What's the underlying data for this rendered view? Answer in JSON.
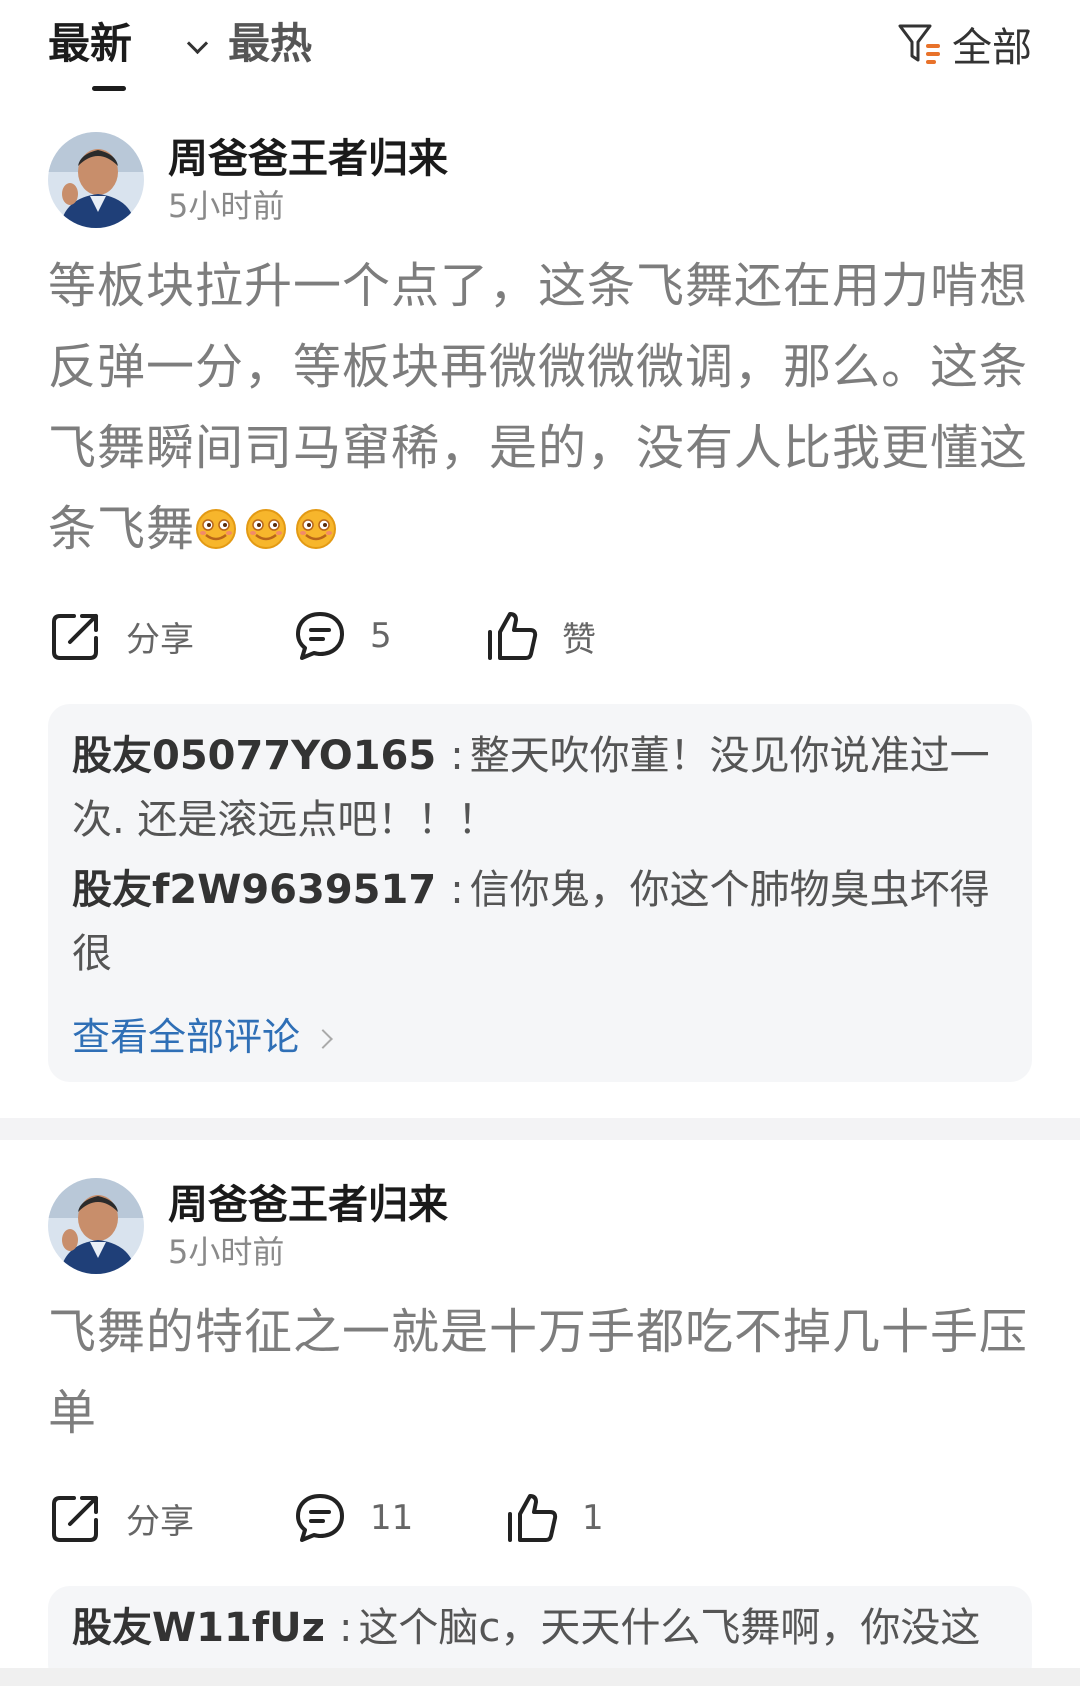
{
  "tabs": {
    "latest": "最新",
    "hot": "最热"
  },
  "filter": {
    "label": "全部"
  },
  "posts": [
    {
      "author": "周爸爸王者归来",
      "time": "5小时前",
      "content": "等板块拉升一个点了，这条飞舞还在用力啃想反弹一分，等板块再微微微微调，那么。这条飞舞瞬间司马窜稀，是的，没有人比我更懂这条飞舞",
      "emoji_count": 3,
      "actions": {
        "share": "分享",
        "comments": "5",
        "like": "赞"
      },
      "replies": [
        {
          "user": "股友05077YO165",
          "text": "整天吹你董！没见你说准过一次. 还是滚远点吧！！！"
        },
        {
          "user": "股友f2W9639517",
          "text": "信你鬼，你这个肺物臭虫坏得很"
        }
      ],
      "view_all": "查看全部评论"
    },
    {
      "author": "周爸爸王者归来",
      "time": "5小时前",
      "content": "飞舞的特征之一就是十万手都吃不掉几十手压单",
      "actions": {
        "share": "分享",
        "comments": "11",
        "like": "1"
      },
      "replies": [
        {
          "user": "股友W11fUz",
          "text": "这个脑c，天天什么飞舞啊，你没这"
        }
      ]
    }
  ],
  "icons": [
    "filter-icon",
    "share-icon",
    "comment-icon",
    "thumbs-up-icon",
    "chevron-down-icon",
    "chevron-right-icon",
    "grin-emoji-icon"
  ]
}
